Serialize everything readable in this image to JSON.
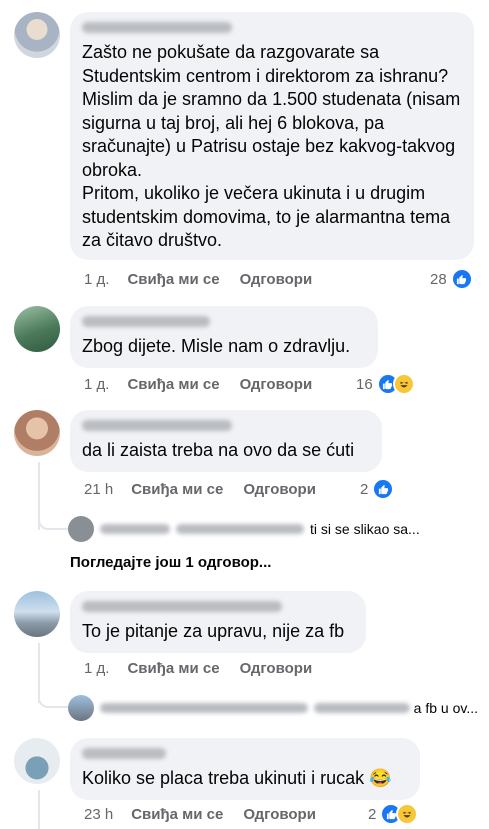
{
  "comments": [
    {
      "text": "Zašto ne pokušate da razgovarate sa Studentskim centrom i direktorom za ishranu? Mislim da je sramno da 1.500 studenata (nisam sigurna u taj broj, ali hej 6 blokova, pa sračunajte) u Patrisu ostaje bez kakvog-takvog obroka.\nPritom, ukoliko je večera ukinuta i u drugim studentskim domovima, to je alarmantna tema za čitavo društvo.",
      "time": "1 д.",
      "like_label": "Свиђа ми се",
      "reply_label": "Одговори",
      "reaction_count": "28"
    },
    {
      "text": "Zbog dijete. Misle nam o zdravlju.",
      "time": "1 д.",
      "like_label": "Свиђа ми се",
      "reply_label": "Одговори",
      "reaction_count": "16"
    },
    {
      "text": "da li zaista treba na ovo da se ćuti",
      "time": "21 h",
      "like_label": "Свиђа ми се",
      "reply_label": "Одговори",
      "reaction_count": "2",
      "reply_preview": "ti si se slikao sa...",
      "view_more": "Погледајте још 1 одговор..."
    },
    {
      "text": "To je pitanje za upravu, nije za fb",
      "time": "1 д.",
      "like_label": "Свиђа ми се",
      "reply_label": "Одговори",
      "reply_preview": "a fb u ov..."
    },
    {
      "text": "Koliko se placa treba ukinuti i rucak 😂",
      "time": "23 h",
      "like_label": "Свиђа ми се",
      "reply_label": "Одговори",
      "reaction_count": "2"
    }
  ],
  "icons": {
    "like": "like-icon",
    "haha": "haha-icon"
  },
  "colors": {
    "bubble": "#f0f2f5",
    "meta_text": "#65676b",
    "like_blue": "#1877f2",
    "haha_yellow": "#f7c737"
  }
}
